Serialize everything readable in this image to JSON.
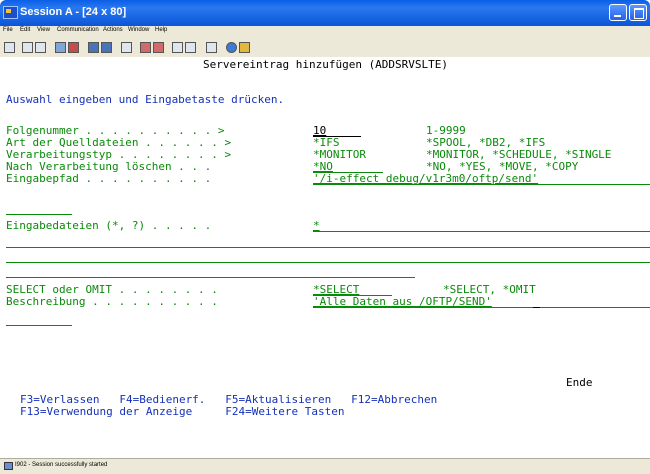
{
  "window": {
    "title": "Session A - [24 x 80]",
    "titlebar_color": "#0a5fe6"
  },
  "menu": {
    "items": [
      "File",
      "Edit",
      "View",
      "Communication",
      "Actions",
      "Window",
      "Help"
    ]
  },
  "toolbar": {
    "icons": [
      "print-screen-icon",
      "copy-icon",
      "paste-icon",
      "send-icon",
      "receive-icon",
      "display-icon",
      "keypad-icon",
      "macro-record-icon",
      "macro-play-icon",
      "macro-stop-icon",
      "settings-icon",
      "macro-icon",
      "clipboard-icon",
      "globe-icon",
      "pencil-icon"
    ]
  },
  "screen": {
    "heading": "Servereintrag hinzufügen (ADDSRVSLTE)",
    "instruction": "Auswahl eingeben und Eingabetaste drücken.",
    "fields": [
      {
        "label": "Folgenummer . . . . . . . . . . >",
        "value": "10",
        "hint": "1-9999"
      },
      {
        "label": "Art der Quelldateien . . . . . . >",
        "value": "*IFS",
        "hint": "*SPOOL, *DB2, *IFS"
      },
      {
        "label": "Verarbeitungstyp . . . . . . . . >",
        "value": "*MONITOR",
        "hint": "*MONITOR, *SCHEDULE, *SINGLE"
      },
      {
        "label": "Nach Verarbeitung löschen . . .",
        "value": "*NO",
        "hint": "*NO, *YES, *MOVE, *COPY"
      },
      {
        "label": "Eingabepfad . . . . . . . . . .",
        "value": "'/i-effect_debug/v1r3m0/oftp/send'",
        "hint": ""
      },
      {
        "label": "Eingabedateien (*, ?) . . . . .",
        "value": "*",
        "hint": ""
      },
      {
        "label": "SELECT oder OMIT . . . . . . . .",
        "value": "*SELECT",
        "hint": "*SELECT, *OMIT"
      },
      {
        "label": "Beschreibung . . . . . . . . . .",
        "value": "'Alle Daten aus /OFTP/SEND'",
        "hint": ""
      }
    ],
    "more_indicator": "Ende",
    "fkeys_line1": "F3=Verlassen   F4=Bedienerf.   F5=Aktualisieren   F12=Abbrechen",
    "fkeys_line2": "F13=Verwendung der Anzeige     F24=Weitere Tasten"
  },
  "status": {
    "text": "I902 - Session successfully started"
  }
}
